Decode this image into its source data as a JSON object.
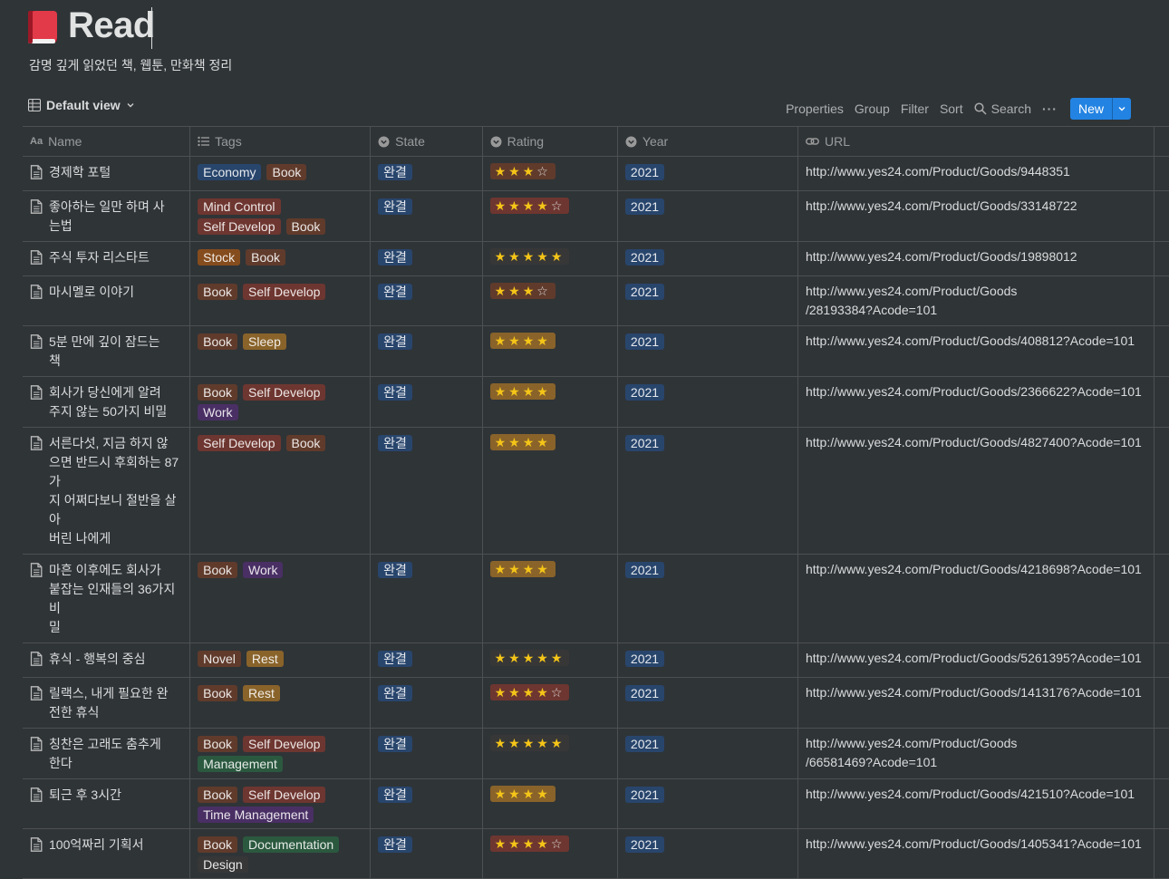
{
  "page": {
    "title": "Read",
    "subtitle": "감명 깊게 읽었던 책, 웹툰, 만화책 정리"
  },
  "view": {
    "label": "Default view"
  },
  "toolbar": {
    "properties": "Properties",
    "group": "Group",
    "filter": "Filter",
    "sort": "Sort",
    "search": "Search",
    "more": "···",
    "new": "New"
  },
  "columns": [
    "Name",
    "Tags",
    "State",
    "Rating",
    "Year",
    "URL"
  ],
  "tag_colors": {
    "Economy": "#28456c",
    "Book": "#603b2c",
    "Mind Control": "#6e3630",
    "Self Develop": "#6e3630",
    "Stock": "#854c1d",
    "Sleep": "#89632a",
    "Work": "#492f64",
    "Novel": "#603b2c",
    "Rest": "#89632a",
    "Management": "#2b593f",
    "Time Management": "#492f64",
    "Documentation": "#2b593f",
    "Design": "#373737"
  },
  "rating_colors": {
    "3": "#603b2c",
    "4": "#89632a",
    "5": "#373737",
    "3r": "#603b2c",
    "4r": "#6e3630"
  },
  "state_color": "#28456c",
  "year_color": "#28456c",
  "rows": [
    {
      "name": [
        "경제학 포털"
      ],
      "tags": [
        "Economy",
        "Book"
      ],
      "state": "완결",
      "rating": 3,
      "rating_half": true,
      "rating_bg": "#603b2c",
      "year": "2021",
      "url": [
        "http://www.yes24.com/Product/Goods/9448351"
      ]
    },
    {
      "name": [
        "좋아하는 일만 하며 사",
        "는법"
      ],
      "tags": [
        "Mind Control",
        "Self Develop",
        "Book"
      ],
      "state": "완결",
      "rating": 4,
      "rating_half": true,
      "rating_bg": "#6e3630",
      "year": "2021",
      "url": [
        "http://www.yes24.com/Product/Goods/33148722"
      ]
    },
    {
      "name": [
        "주식 투자 리스타트"
      ],
      "tags": [
        "Stock",
        "Book"
      ],
      "state": "완결",
      "rating": 5,
      "rating_half": false,
      "rating_bg": "#373737",
      "year": "2021",
      "url": [
        "http://www.yes24.com/Product/Goods/19898012"
      ]
    },
    {
      "name": [
        "마시멜로 이야기"
      ],
      "tags": [
        "Book",
        "Self Develop"
      ],
      "state": "완결",
      "rating": 3,
      "rating_half": true,
      "rating_bg": "#603b2c",
      "year": "2021",
      "url": [
        "http://www.yes24.com/Product/Goods",
        "/28193384?Acode=101"
      ]
    },
    {
      "name": [
        "5분 만에 깊이 잠드는",
        "책"
      ],
      "tags": [
        "Book",
        "Sleep"
      ],
      "state": "완결",
      "rating": 4,
      "rating_half": false,
      "rating_bg": "#89632a",
      "year": "2021",
      "url": [
        "http://www.yes24.com/Product/Goods/408812?Acode=101"
      ]
    },
    {
      "name": [
        "회사가 당신에게 알려",
        "주지 않는 50가지 비밀"
      ],
      "tags": [
        "Book",
        "Self Develop",
        "Work"
      ],
      "state": "완결",
      "rating": 4,
      "rating_half": false,
      "rating_bg": "#89632a",
      "year": "2021",
      "url": [
        "http://www.yes24.com/Product/Goods/2366622?Acode=101"
      ]
    },
    {
      "name": [
        "서른다섯, 지금 하지 않",
        "으면 반드시 후회하는 87가",
        "지 어쩌다보니 절반을 살아",
        "버린 나에게"
      ],
      "tags": [
        "Self Develop",
        "Book"
      ],
      "state": "완결",
      "rating": 4,
      "rating_half": false,
      "rating_bg": "#89632a",
      "year": "2021",
      "url": [
        "http://www.yes24.com/Product/Goods/4827400?Acode=101"
      ]
    },
    {
      "name": [
        "마흔 이후에도 회사가",
        "붙잡는 인재들의 36가지 비",
        "밀"
      ],
      "tags": [
        "Book",
        "Work"
      ],
      "state": "완결",
      "rating": 4,
      "rating_half": false,
      "rating_bg": "#89632a",
      "year": "2021",
      "url": [
        "http://www.yes24.com/Product/Goods/4218698?Acode=101"
      ]
    },
    {
      "name": [
        "휴식 - 행복의 중심"
      ],
      "tags": [
        "Novel",
        "Rest"
      ],
      "state": "완결",
      "rating": 5,
      "rating_half": false,
      "rating_bg": "#373737",
      "year": "2021",
      "url": [
        "http://www.yes24.com/Product/Goods/5261395?Acode=101"
      ]
    },
    {
      "name": [
        "릴랙스, 내게 필요한 완",
        "전한 휴식"
      ],
      "tags": [
        "Book",
        "Rest"
      ],
      "state": "완결",
      "rating": 4,
      "rating_half": true,
      "rating_bg": "#6e3630",
      "year": "2021",
      "url": [
        "http://www.yes24.com/Product/Goods/1413176?Acode=101"
      ]
    },
    {
      "name": [
        "칭찬은 고래도 춤추게",
        "한다"
      ],
      "tags": [
        "Book",
        "Self Develop",
        "Management"
      ],
      "state": "완결",
      "rating": 5,
      "rating_half": false,
      "rating_bg": "#373737",
      "year": "2021",
      "url": [
        "http://www.yes24.com/Product/Goods",
        "/66581469?Acode=101"
      ]
    },
    {
      "name": [
        "퇴근 후 3시간"
      ],
      "tags": [
        "Book",
        "Self Develop",
        "Time Management"
      ],
      "state": "완결",
      "rating": 4,
      "rating_half": false,
      "rating_bg": "#89632a",
      "year": "2021",
      "url": [
        "http://www.yes24.com/Product/Goods/421510?Acode=101"
      ]
    },
    {
      "name": [
        "100억짜리 기획서"
      ],
      "tags": [
        "Book",
        "Documentation",
        "Design"
      ],
      "state": "완결",
      "rating": 4,
      "rating_half": true,
      "rating_bg": "#6e3630",
      "year": "2021",
      "url": [
        "http://www.yes24.com/Product/Goods/1405341?Acode=101"
      ]
    }
  ]
}
